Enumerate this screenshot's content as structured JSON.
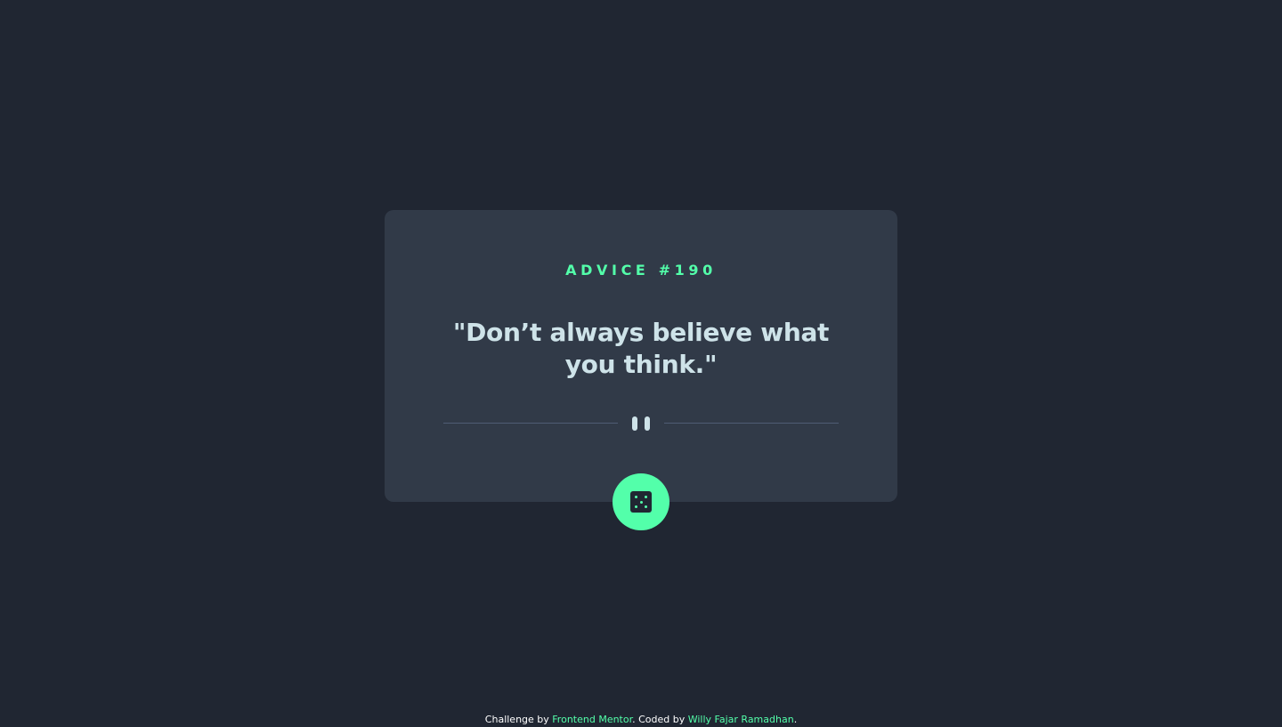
{
  "advice": {
    "id_label": "ADVICE #190",
    "quote": "\"Don’t always believe what you think.\""
  },
  "divider": {
    "icon": "pause-quote-icon"
  },
  "button": {
    "icon": "dice-icon"
  },
  "footer": {
    "prefix": "Challenge by",
    "challenge_link": "Frontend Mentor",
    "middle": ". Coded by",
    "author_link": "Willy Fajar Ramadhan",
    "suffix": "."
  },
  "colors": {
    "background": "#202632",
    "card": "#313a48",
    "accent": "#53ffaa",
    "text": "#cee3e9",
    "divider": "#4f5d74"
  }
}
